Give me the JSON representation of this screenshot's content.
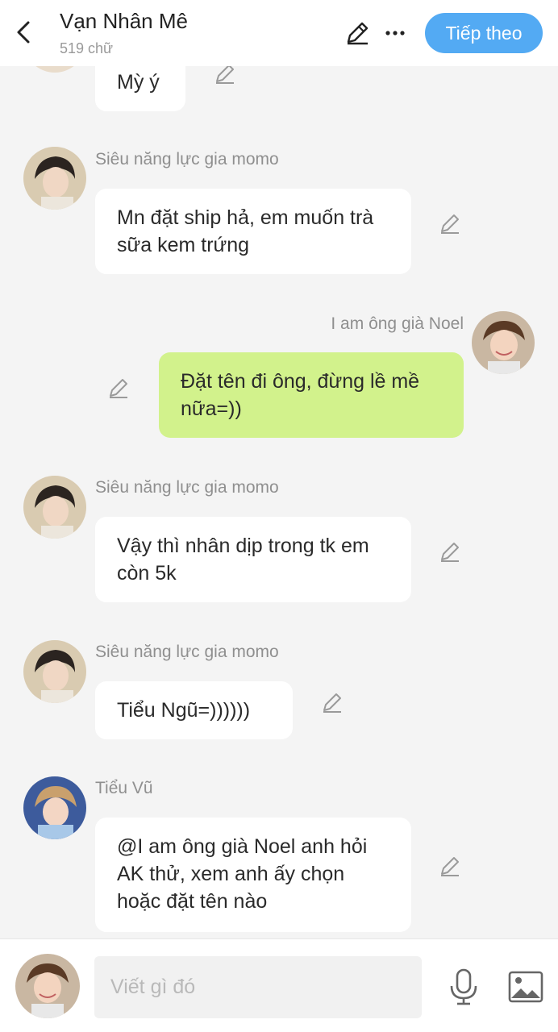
{
  "header": {
    "title": "Vạn Nhân Mê",
    "word_count": "519 chữ",
    "next_label": "Tiếp theo"
  },
  "messages": [
    {
      "sender": "",
      "text": "Mỳ ý",
      "side": "left"
    },
    {
      "sender": "Siêu năng lực gia momo",
      "text": "Mn đặt ship hả, em muốn trà sữa kem trứng",
      "side": "left"
    },
    {
      "sender": "I am ông già Noel",
      "text": "Đặt tên đi ông, đừng lề mề nữa=))",
      "side": "right"
    },
    {
      "sender": "Siêu năng lực gia momo",
      "text": "Vậy thì nhân dịp trong tk em còn 5k",
      "side": "left"
    },
    {
      "sender": "Siêu năng lực gia momo",
      "text": "Tiểu Ngũ=))))))",
      "side": "left"
    },
    {
      "sender": "Tiểu Vũ",
      "text": "@I am ông già Noel anh hỏi AK thử, xem anh ấy chọn hoặc đặt tên nào",
      "side": "left"
    }
  ],
  "composer": {
    "placeholder": "Viết gì đó"
  },
  "colors": {
    "accent": "#53aaf3",
    "own_bubble": "#d2f28c",
    "other_bubble": "#ffffff",
    "background": "#f4f4f4"
  },
  "icons": [
    "back-arrow-icon",
    "pencil-icon",
    "more-icon",
    "microphone-icon",
    "image-icon"
  ]
}
